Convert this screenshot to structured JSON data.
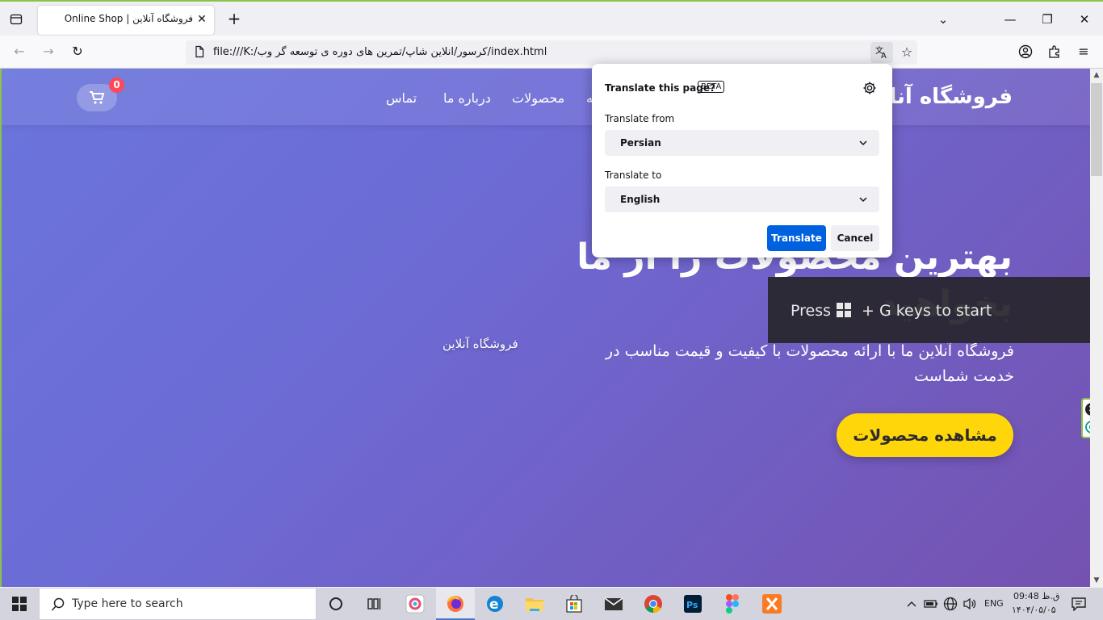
{
  "browser": {
    "tab_title": "Online Shop | فروشگاه آنلاین",
    "tab_close": "✕",
    "new_tab": "+",
    "url": "file:///K:/کرسور/انلاین شاپ/تمرین های دوره ی توسعه گر وب/index.html",
    "win_controls": {
      "dropdown": "⌄",
      "minimize": "—",
      "restore": "❐",
      "close": "✕"
    }
  },
  "site": {
    "logo": "فروشگاه آنلاین",
    "nav": [
      "تماس",
      "درباره ما",
      "محصولات",
      "خانه"
    ],
    "cart_count": "0",
    "hero_title": "بهترین محصولات را از ما بخواهید",
    "hero_desc": "فروشگاه آنلاین ما با ارائه محصولات با کیفیت و قیمت مناسب در خدمت شماست",
    "hero_cta": "مشاهده محصولات",
    "floating_label": "فروشگاه آنلاین"
  },
  "translate_popup": {
    "title": "Translate this page?",
    "beta": "BETA",
    "from_label": "Translate from",
    "from_value": "Persian",
    "to_label": "Translate to",
    "to_value": "English",
    "translate_btn": "Translate",
    "cancel_btn": "Cancel"
  },
  "gamebar_toast": {
    "press": "Press",
    "rest": "+ G keys to start"
  },
  "taskbar": {
    "search_placeholder": "Type here to search",
    "lang": "ENG",
    "time": "09:48 ق.ظ",
    "date": "۱۴۰۴/۰۵/۰۵"
  },
  "colors": {
    "accent_blue": "#0061e0",
    "cta_yellow": "#ffd60a",
    "badge_red": "#ff4757",
    "hero_gradient_start": "#6a75dc",
    "hero_gradient_end": "#7552b0"
  }
}
